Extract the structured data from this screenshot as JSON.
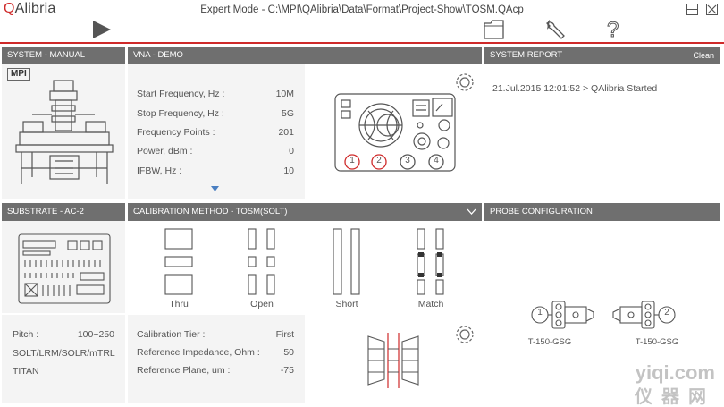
{
  "app": {
    "logo_q": "Q",
    "logo_rest": "Alibria",
    "title": "Expert Mode - C:\\MPI\\QAlibria\\Data\\Format\\Project-Show\\TOSM.QAcp"
  },
  "panels": {
    "system": {
      "header": "SYSTEM - MANUAL",
      "brand": "MPI"
    },
    "vna": {
      "header": "VNA - DEMO",
      "rows": [
        {
          "label": "Start Frequency, Hz :",
          "value": "10M"
        },
        {
          "label": "Stop Frequency, Hz :",
          "value": "5G"
        },
        {
          "label": "Frequency Points :",
          "value": "201"
        },
        {
          "label": "Power, dBm :",
          "value": "0"
        },
        {
          "label": "IFBW, Hz :",
          "value": "10"
        }
      ],
      "ports": [
        "1",
        "2",
        "3",
        "4"
      ]
    },
    "report": {
      "header": "SYSTEM REPORT",
      "clean_label": "Clean",
      "entries": [
        "21.Jul.2015 12:01:52 > QAlibria Started"
      ]
    },
    "substrate": {
      "header": "SUBSTRATE - AC-2",
      "rows": [
        {
          "label": "Pitch :",
          "value": "100~250"
        },
        {
          "label": "SOLT/LRM/SOLR/mTRL",
          "value": ""
        },
        {
          "label": "TITAN",
          "value": ""
        }
      ]
    },
    "calibration": {
      "header": "CALIBRATION METHOD - TOSM(SOLT)",
      "standards": [
        "Thru",
        "Open",
        "Short",
        "Match"
      ],
      "rows": [
        {
          "label": "Calibration Tier :",
          "value": "First"
        },
        {
          "label": "Reference Impedance, Ohm :",
          "value": "50"
        },
        {
          "label": "Reference Plane, um :",
          "value": "-75"
        }
      ]
    },
    "probe": {
      "header": "PROBE CONFIGURATION",
      "port_left": "1",
      "port_right": "2",
      "probe_left": "T-150-GSG",
      "probe_right": "T-150-GSG"
    }
  },
  "watermark": {
    "line1": "yiqi.com",
    "line2": "仪器网"
  },
  "colors": {
    "accent": "#cf2a2a",
    "header_bg": "#6f6f6f",
    "panel_bg": "#f4f4f4"
  }
}
